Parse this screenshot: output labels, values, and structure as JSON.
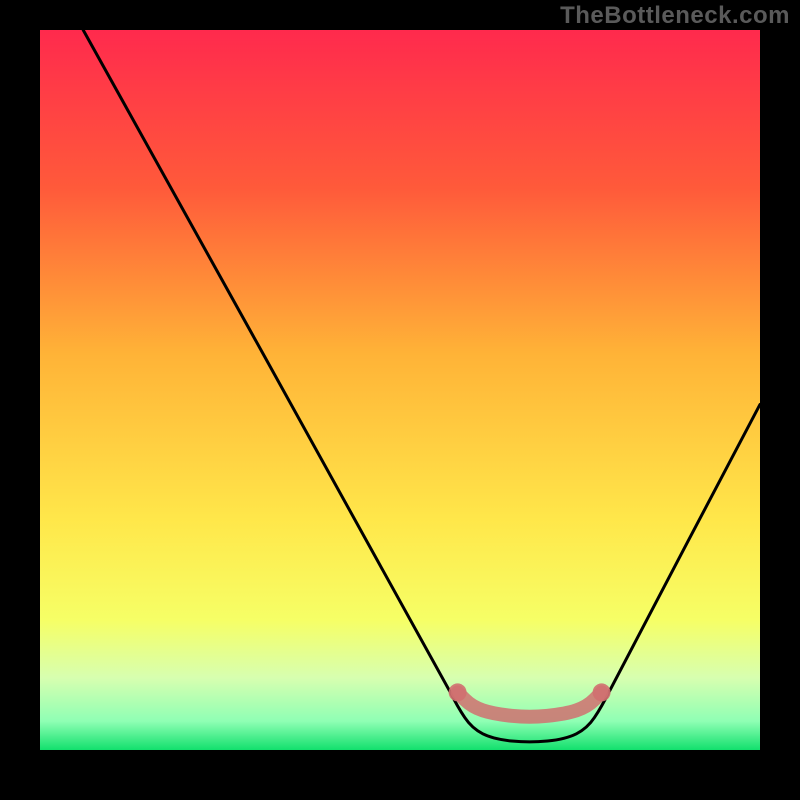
{
  "watermark": "TheBottleneck.com",
  "chart_data": {
    "type": "line",
    "title": "",
    "xlabel": "",
    "ylabel": "",
    "xlim": [
      0,
      100
    ],
    "ylim": [
      0,
      100
    ],
    "background_gradient": {
      "stops": [
        {
          "pct": 0,
          "color": "#ff2a4d"
        },
        {
          "pct": 22,
          "color": "#ff5a3a"
        },
        {
          "pct": 45,
          "color": "#ffb337"
        },
        {
          "pct": 68,
          "color": "#ffe74a"
        },
        {
          "pct": 82,
          "color": "#f6ff66"
        },
        {
          "pct": 90,
          "color": "#d7ffb0"
        },
        {
          "pct": 96,
          "color": "#8fffb4"
        },
        {
          "pct": 100,
          "color": "#12e06d"
        }
      ]
    },
    "series": [
      {
        "name": "bottleneck-curve",
        "color": "#000000",
        "points": [
          {
            "x": 6,
            "y": 100
          },
          {
            "x": 56,
            "y": 10
          },
          {
            "x": 58,
            "y": 6
          },
          {
            "x": 60,
            "y": 3
          },
          {
            "x": 63,
            "y": 1.5
          },
          {
            "x": 68,
            "y": 1
          },
          {
            "x": 73,
            "y": 1.5
          },
          {
            "x": 76,
            "y": 3
          },
          {
            "x": 78,
            "y": 6
          },
          {
            "x": 80,
            "y": 10
          },
          {
            "x": 100,
            "y": 48
          }
        ]
      }
    ],
    "annotations": [
      {
        "name": "flat-band-marker",
        "color": "#d07070",
        "points": [
          {
            "x": 58,
            "y": 8
          },
          {
            "x": 60,
            "y": 6
          },
          {
            "x": 63,
            "y": 5
          },
          {
            "x": 68,
            "y": 4.5
          },
          {
            "x": 73,
            "y": 5
          },
          {
            "x": 76,
            "y": 6
          },
          {
            "x": 78,
            "y": 8
          }
        ]
      }
    ]
  }
}
